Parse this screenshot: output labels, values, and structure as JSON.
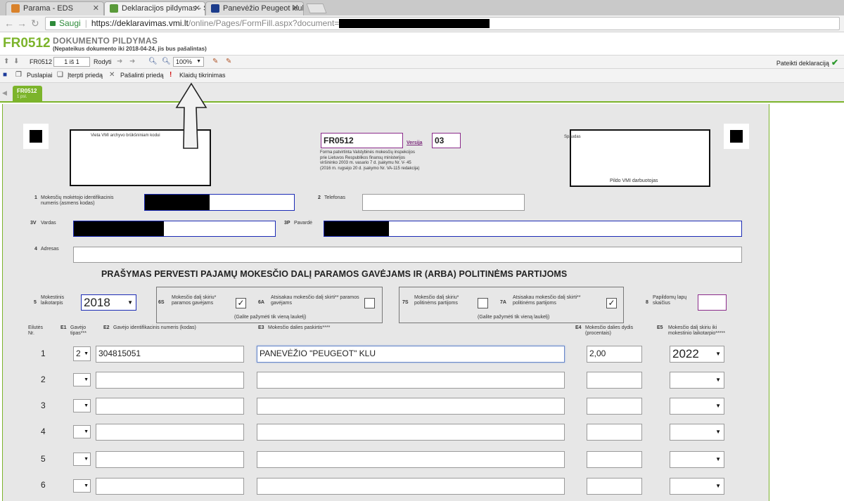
{
  "browser": {
    "tabs": [
      {
        "title": "Parama - EDS",
        "favicon_color": "#d9822b"
      },
      {
        "title": "Deklaracijos pildymas - Š",
        "favicon_color": "#5a9a3a"
      },
      {
        "title": "Panevėžio Peugeot klubas",
        "favicon_color": "#1c3c8c"
      }
    ],
    "secure_label": "Saugi",
    "url_host": "https://deklaravimas.vmi.lt",
    "url_path": "/online/Pages/FormFill.aspx?document="
  },
  "header": {
    "form_code": "FR0512",
    "doc_title": "DOKUMENTO PILDYMAS",
    "doc_note": "(Nepateikus dokumento iki 2018-04-24, jis bus pašalintas)"
  },
  "toolbar1": {
    "form_code": "FR0512",
    "page_indicator": "1 iš 1",
    "show_label": "Rodyti",
    "zoom": "100%",
    "submit_label": "Pateikti deklaraciją"
  },
  "toolbar2": {
    "pages_label": "Puslapiai",
    "insert_label": "Įterpti priedą",
    "remove_label": "Pašalinti priedą",
    "errors_label": "Klaidų tikrinimas"
  },
  "page_tab": {
    "code": "FR0512",
    "page": "1 psl."
  },
  "form": {
    "archive_label": "Vieta VMI archyvo brūkšniniam kodui",
    "form_code": "FR0512",
    "version_label": "Versija",
    "version": "03",
    "approval_text": [
      "Forma patvirtinta Valstybinės mokesčių inspekcijos",
      "prie Lietuvos Respublikos finansų ministerijos",
      "viršininko 2003 m. vasario 7 d. įsakymu Nr. V- 45",
      "(2016 m. rugsėjo 20 d. įsakymo Nr. VA-115 redakcija)"
    ],
    "stamp_label": "Spaudas",
    "stamp_sub": "Pildo VMI darbuotojas",
    "f1_num": "1",
    "f1_label_a": "Mokesčių mokėtojo identifikacinis",
    "f1_label_b": "numeris (asmens kodas)",
    "f2_num": "2",
    "f2_label": "Telefonas",
    "f3v_num": "3V",
    "f3v_label": "Vardas",
    "f3p_num": "3P",
    "f3p_label": "Pavardė",
    "f4_num": "4",
    "f4_label": "Adresas",
    "main_title": "PRAŠYMAS PERVESTI PAJAMŲ MOKESČIO DALĮ PARAMOS GAVĖJAMS IR (ARBA) POLITINĖMS PARTIJOMS",
    "f5_num": "5",
    "f5_label_a": "Mokestinis",
    "f5_label_b": "laikotarpis",
    "f5_value": "2018",
    "f6s_num": "6S",
    "f6s_label_a": "Mokesčio dalį skiriu*",
    "f6s_label_b": "paramos gavėjams",
    "f6a_num": "6A",
    "f6a_label_a": "Atsisakau mokesčio dalį skirti** paramos",
    "f6a_label_b": "gavėjams",
    "group_hint": "(Galite pažymėti tik vieną laukelį)",
    "f7s_num": "7S",
    "f7s_label_a": "Mokesčio dalį skiriu*",
    "f7s_label_b": "politinėms partijoms",
    "f7a_num": "7A",
    "f7a_label_a": "Atsisakau mokesčio dalį skirti**",
    "f7a_label_b": "politinėms partijoms",
    "f8_num": "8",
    "f8_label_a": "Papildomų lapų",
    "f8_label_b": "skaičius",
    "check_6s": "✓",
    "check_6a": "",
    "check_7s": "",
    "check_7a": "✓",
    "col_row": "Eilutės Nr.",
    "col_e1_code": "E1",
    "col_e1": "Gavėjo tipas***",
    "col_e2_code": "E2",
    "col_e2": "Gavėjo identifikacinis numeris (kodas)",
    "col_e3_code": "E3",
    "col_e3": "Mokesčio dalies paskirtis****",
    "col_e4_code": "E4",
    "col_e4_a": "Mokesčio dalies dydis",
    "col_e4_b": "(procentais)",
    "col_e5_code": "E5",
    "col_e5_a": "Mokesčio dalį skiriu iki",
    "col_e5_b": "mokestinio laikotarpio*****",
    "rows": [
      {
        "no": "1",
        "type": "2",
        "code": "304815051",
        "purpose": "PANEVĖŽIO \"PEUGEOT\" KLU",
        "percent": "2,00",
        "year": "2022"
      },
      {
        "no": "2",
        "type": "",
        "code": "",
        "purpose": "",
        "percent": "",
        "year": ""
      },
      {
        "no": "3",
        "type": "",
        "code": "",
        "purpose": "",
        "percent": "",
        "year": ""
      },
      {
        "no": "4",
        "type": "",
        "code": "",
        "purpose": "",
        "percent": "",
        "year": ""
      },
      {
        "no": "5",
        "type": "",
        "code": "",
        "purpose": "",
        "percent": "",
        "year": ""
      },
      {
        "no": "6",
        "type": "",
        "code": "",
        "purpose": "",
        "percent": "",
        "year": ""
      }
    ]
  },
  "colors": {
    "accent": "#7cb42b",
    "field_blue": "#1b2bb5",
    "field_purple": "#8a2a8a"
  }
}
